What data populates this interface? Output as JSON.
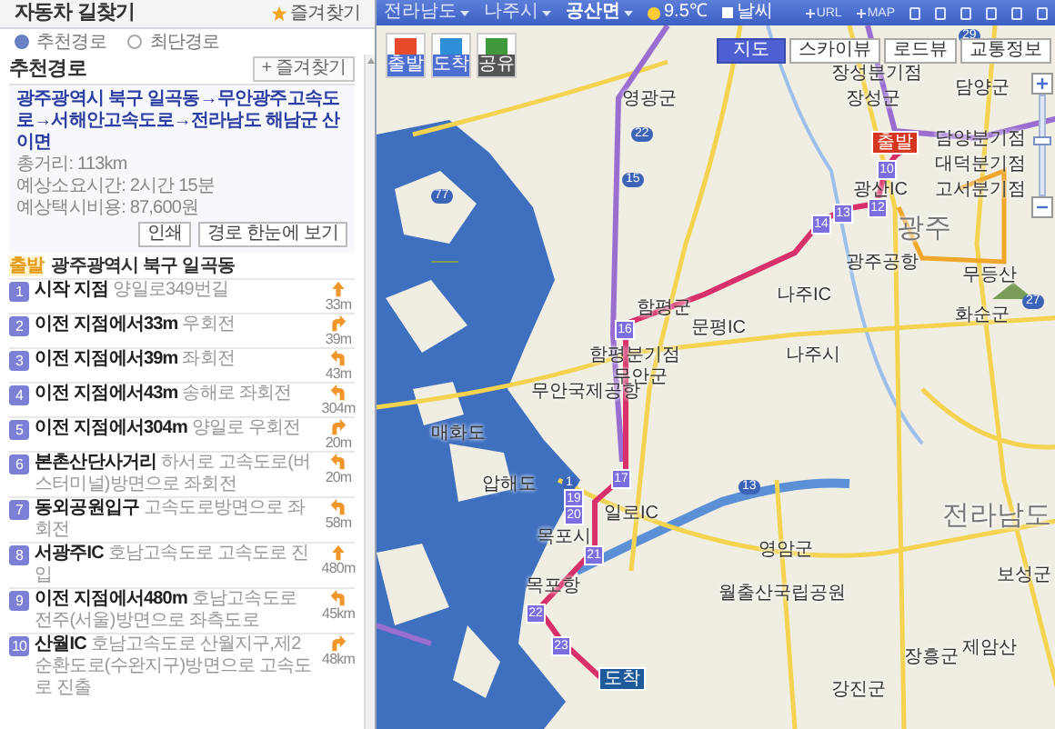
{
  "sidebar": {
    "title": "자동차 길찾기",
    "favorite": "즐겨찾기",
    "route_options": [
      {
        "label": "추천경로",
        "selected": true
      },
      {
        "label": "최단경로",
        "selected": false
      }
    ],
    "route": {
      "title": "추천경로",
      "favorite_button": "+ 즐겨찾기",
      "summary_link": "광주광역시 북구 일곡동→무안광주고속도로→서해안고속도로→전라남도 해남군 산이면",
      "details": [
        "총거리: 113km",
        "예상소요시간: 2시간 15분",
        "예상택시비용: 87,600원"
      ],
      "buttons": [
        "인쇄",
        "경로 한눈에 보기"
      ]
    },
    "start": {
      "badge": "출발",
      "place": "광주광역시 북구 일곡동"
    },
    "steps": [
      {
        "number": "1",
        "point": "시작 지점",
        "instruction": "양일로349번길",
        "kind": "straight",
        "distance": "33m"
      },
      {
        "number": "2",
        "point": "이전 지점에서33m",
        "instruction": "우회전",
        "kind": "right",
        "distance": "39m"
      },
      {
        "number": "3",
        "point": "이전 지점에서39m",
        "instruction": "좌회전",
        "kind": "left",
        "distance": "43m"
      },
      {
        "number": "4",
        "point": "이전 지점에서43m",
        "instruction": "송해로 좌회전",
        "kind": "left",
        "distance": "304m"
      },
      {
        "number": "5",
        "point": "이전 지점에서304m",
        "instruction": "양일로 우회전",
        "kind": "right",
        "distance": "20m"
      },
      {
        "number": "6",
        "point": "본촌산단사거리",
        "instruction": "하서로 고속도로(버스터미널)방면으로 좌회전",
        "kind": "left",
        "distance": "20m"
      },
      {
        "number": "7",
        "point": "동외공원입구",
        "instruction": "고속도로방면으로 좌회전",
        "kind": "left",
        "distance": "58m"
      },
      {
        "number": "8",
        "point": "서광주IC",
        "instruction": "호남고속도로 고속도로 진입",
        "kind": "straight",
        "distance": "480m"
      },
      {
        "number": "9",
        "point": "이전 지점에서480m",
        "instruction": "호남고속도로 전주(서울)방면으로 좌측도로",
        "kind": "left",
        "distance": "45km"
      },
      {
        "number": "10",
        "point": "산월IC",
        "instruction": "호남고속도로 산월지구,제2순환도로(수완지구)방면으로 고속도로 진출",
        "kind": "right",
        "distance": "48km"
      }
    ]
  },
  "map": {
    "toolbar": {
      "regions": [
        "전라남도",
        "나주시",
        "공산면"
      ],
      "weather": "9.5℃",
      "weather_link": "날씨",
      "links": [
        "URL",
        "MAP"
      ]
    },
    "map_types": [
      {
        "label": "지도",
        "selected": true
      },
      {
        "label": "스카이뷰",
        "selected": false
      },
      {
        "label": "로드뷰",
        "selected": false
      },
      {
        "label": "교통정보",
        "selected": false
      }
    ],
    "markers": [
      {
        "label": "출발",
        "kind": "start"
      },
      {
        "label": "도착",
        "kind": "end"
      },
      {
        "label": "공유",
        "kind": "share"
      }
    ],
    "zoom": {
      "level": 0.55
    },
    "places": [
      "영광군",
      "장성분기점",
      "장성군",
      "담양군",
      "담양분기점",
      "대덕분기점",
      "고서분기점",
      "광산IC",
      "광주",
      "광주공항",
      "무등산",
      "나주IC",
      "함평군",
      "문평IC",
      "화순군",
      "함평분기점",
      "무안군",
      "나주시",
      "무안국제공항",
      "매화도",
      "압해도",
      "일로IC",
      "목포시",
      "목포항",
      "영암군",
      "월출산국립공원",
      "전라남도",
      "보성군",
      "장흥군",
      "제암산",
      "강진군"
    ],
    "route_points": [
      "10",
      "12",
      "13",
      "14",
      "16",
      "17",
      "19",
      "20",
      "21",
      "22",
      "23"
    ],
    "route_start": "출발",
    "route_end": "도착",
    "road_numbers": [
      "22",
      "15",
      "77",
      "1",
      "13",
      "29",
      "27"
    ]
  }
}
